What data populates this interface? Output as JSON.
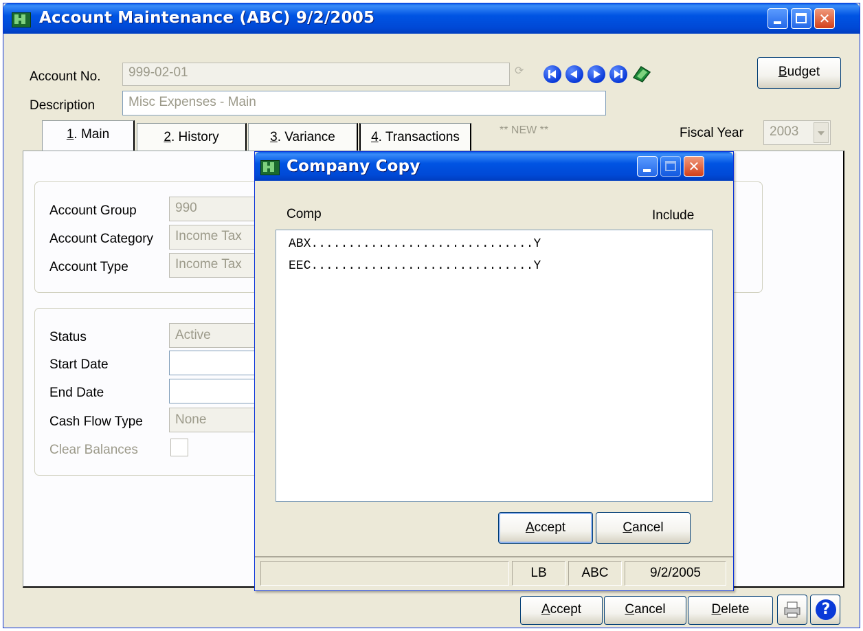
{
  "main_window": {
    "title": "Account Maintenance (ABC) 9/2/2005",
    "account_no_label": "Account No.",
    "account_no_value": "999-02-01",
    "description_label": "Description",
    "description_value": "Misc Expenses - Main",
    "budget_button": {
      "pre": "",
      "mnemonic": "B",
      "post": "udget"
    },
    "new_indicator": "** NEW **",
    "fiscal_year_label": "Fiscal Year",
    "fiscal_year_value": "2003",
    "tabs": [
      {
        "mnemonic": "1",
        "text": ". Main"
      },
      {
        "mnemonic": "2",
        "text": ". History"
      },
      {
        "mnemonic": "3",
        "text": ". Variance"
      },
      {
        "mnemonic": "4",
        "text": ". Transactions"
      }
    ],
    "group1": {
      "account_group_label": "Account Group",
      "account_group_value": "990",
      "account_category_label": "Account Category",
      "account_category_value": "Income Tax",
      "account_type_label": "Account Type",
      "account_type_value": "Income Tax"
    },
    "group2": {
      "status_label": "Status",
      "status_value": "Active",
      "start_date_label": "Start Date",
      "start_date_value": "",
      "end_date_label": "End Date",
      "end_date_value": "",
      "cash_flow_type_label": "Cash Flow Type",
      "cash_flow_type_value": "None",
      "clear_balances_label": "Clear Balances"
    },
    "bottom_buttons": {
      "accept": {
        "mnemonic": "A",
        "rest": "ccept"
      },
      "cancel": {
        "mnemonic": "C",
        "rest": "ancel"
      },
      "delete": {
        "mnemonic": "D",
        "rest": "elete"
      }
    }
  },
  "dialog": {
    "title": "Company Copy",
    "col_comp": "Comp",
    "col_include": "Include",
    "rows": [
      {
        "comp": "ABX",
        "dots": "..............................",
        "include": "Y"
      },
      {
        "comp": "EEC",
        "dots": "..............................",
        "include": "Y"
      }
    ],
    "accept": {
      "mnemonic": "A",
      "rest": "ccept"
    },
    "cancel": {
      "mnemonic": "C",
      "rest": "ancel"
    },
    "status_bar": [
      "",
      "LB",
      "ABC",
      "9/2/2005"
    ]
  },
  "icons": {
    "nav": [
      "first-record-icon",
      "previous-record-icon",
      "next-record-icon",
      "last-record-icon"
    ],
    "colors": {
      "titlebar": "#0054e3",
      "face": "#ece9d8",
      "nav_blue": "#0a3ad8"
    }
  }
}
